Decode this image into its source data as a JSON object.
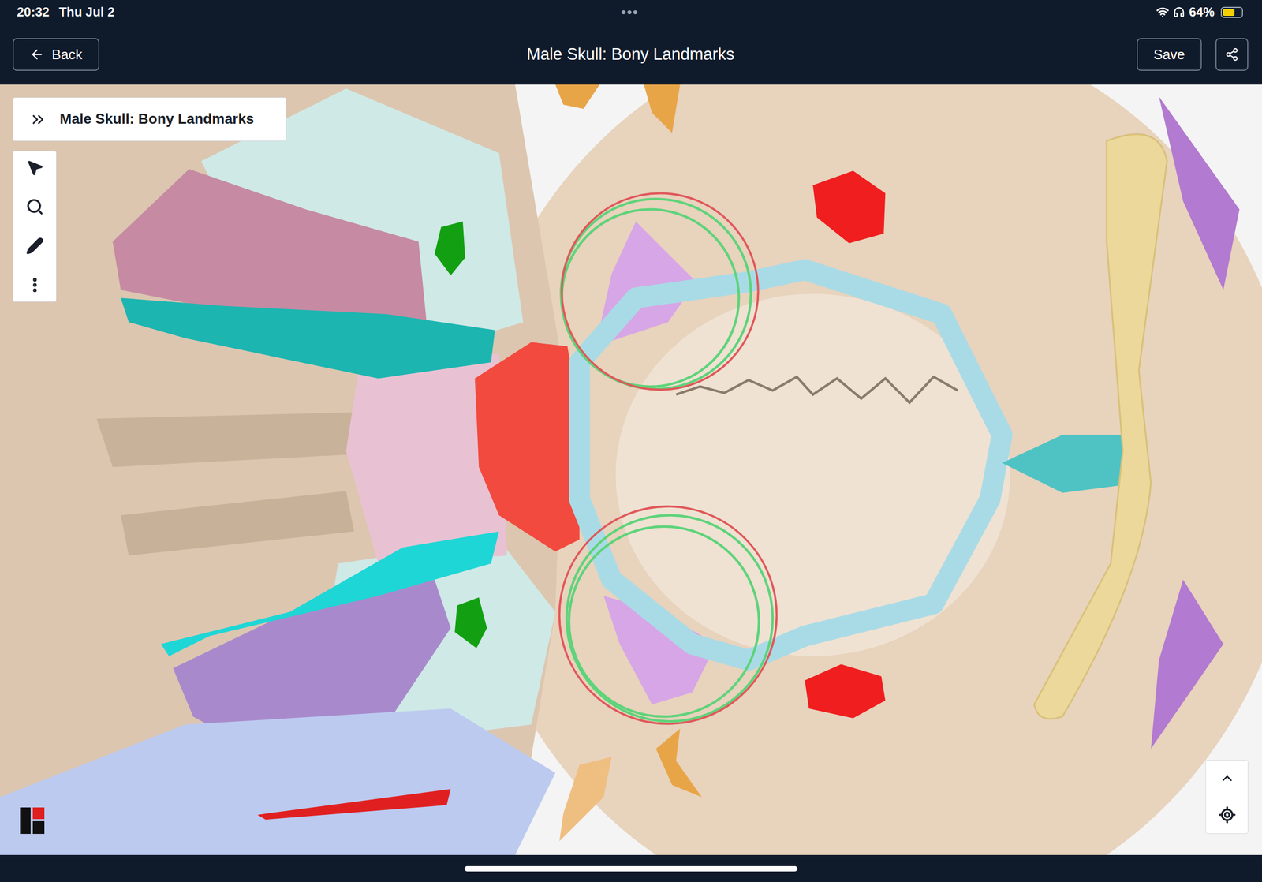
{
  "status_bar": {
    "time": "20:32",
    "date": "Thu Jul 2",
    "dots": "•••",
    "battery": "64%",
    "battery_level": 0.64
  },
  "header": {
    "back": "Back",
    "title": "Male Skull: Bony Landmarks",
    "save": "Save"
  },
  "panel": {
    "title": "Male Skull: Bony Landmarks"
  }
}
